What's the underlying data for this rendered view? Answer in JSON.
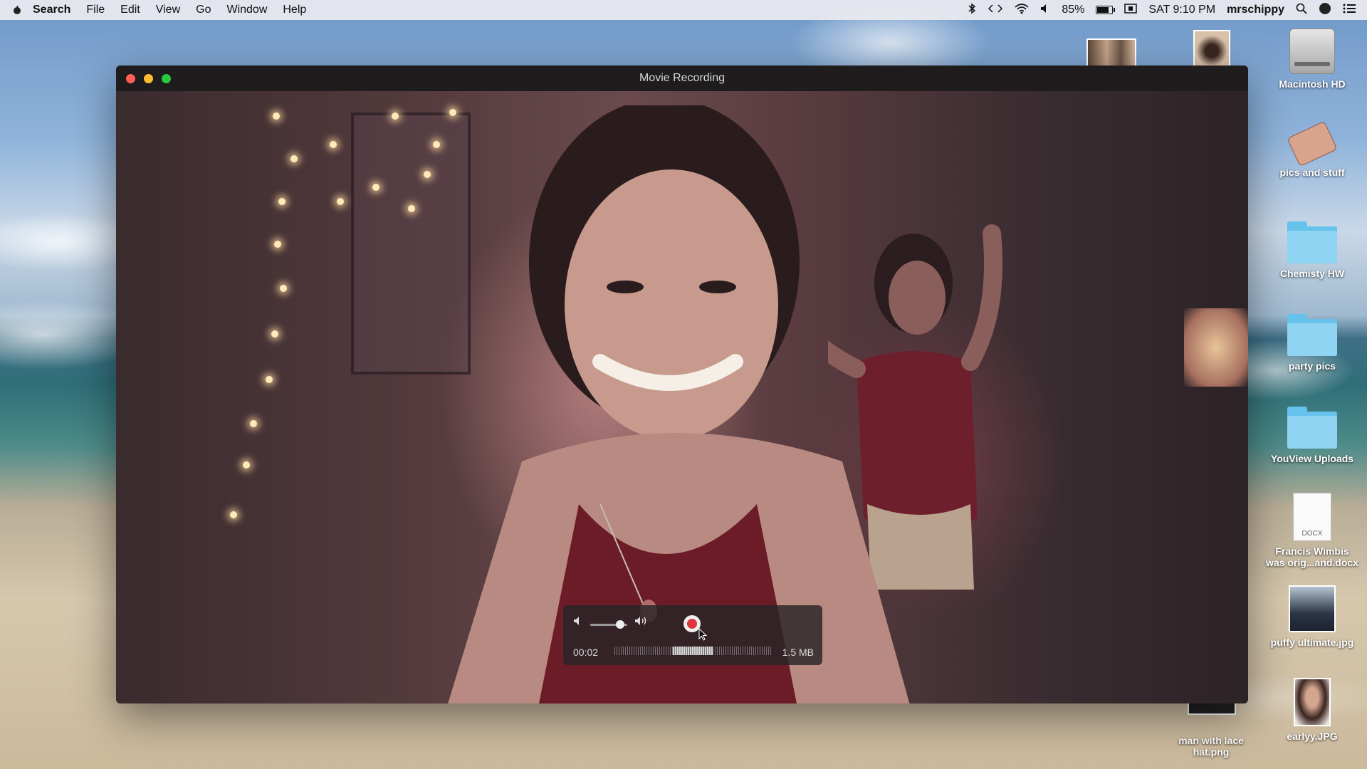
{
  "menubar": {
    "app_name": "Search",
    "menus": [
      "File",
      "Edit",
      "View",
      "Go",
      "Window",
      "Help"
    ],
    "battery_percent": "85%",
    "battery_level": 0.85,
    "clock": "SAT 9:10 PM",
    "user": "mrschippy"
  },
  "window": {
    "title": "Movie Recording",
    "controls": {
      "volume_level": 0.8,
      "elapsed": "00:02",
      "file_size": "1.5 MB"
    }
  },
  "desktop": {
    "icons": [
      {
        "label": "Macintosh HD"
      },
      {
        "label": "pics and stuff"
      },
      {
        "label": "Chemisty HW"
      },
      {
        "label": "party pics"
      },
      {
        "label": "YouView Uploads"
      },
      {
        "label": "Francis Wimbis was orig...and.docx",
        "badge": "DOCX"
      },
      {
        "label": "puffy ultimate.jpg"
      },
      {
        "label": "earlyy.JPG"
      },
      {
        "label": "man with lace hat.png"
      }
    ]
  },
  "colors": {
    "close": "#ff5f57",
    "minimize": "#febc2e",
    "zoom": "#28c840",
    "record": "#e0353a",
    "folder": "#65c2eb"
  }
}
